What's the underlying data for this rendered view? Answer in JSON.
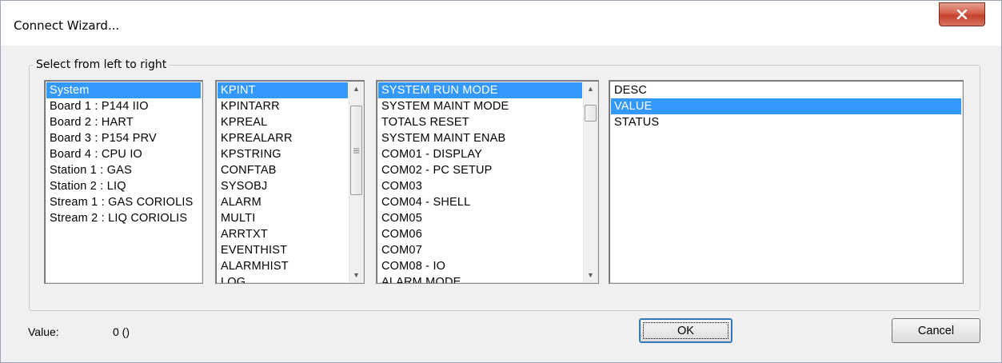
{
  "window": {
    "title": "Connect Wizard...",
    "close_icon": "close-x-icon"
  },
  "group": {
    "label": "Select from left to right"
  },
  "lists": {
    "list1": {
      "items": [
        "System",
        "Board 1 : P144 IIO",
        "Board 2 : HART",
        "Board 3 : P154 PRV",
        "Board 4 : CPU IO",
        "Station 1 : GAS",
        "Station 2 : LIQ",
        "Stream 1 : GAS CORIOLIS",
        "Stream 2 : LIQ CORIOLIS"
      ],
      "selected": "System"
    },
    "list2": {
      "items": [
        "KPINT",
        "KPINTARR",
        "KPREAL",
        "KPREALARR",
        "KPSTRING",
        "CONFTAB",
        "SYSOBJ",
        "ALARM",
        "MULTI",
        "ARRTXT",
        "EVENTHIST",
        "ALARMHIST",
        "LOG"
      ],
      "selected": "KPINT"
    },
    "list3": {
      "items": [
        "SYSTEM RUN MODE",
        "SYSTEM MAINT MODE",
        "TOTALS RESET",
        "SYSTEM MAINT ENAB",
        "COM01 - DISPLAY",
        "COM02 - PC SETUP",
        "COM03",
        "COM04 - SHELL",
        "COM05",
        "COM06",
        "COM07",
        "COM08 - IO",
        "ALARM MODE"
      ],
      "selected": "SYSTEM RUN MODE"
    },
    "list4": {
      "items": [
        "DESC",
        "VALUE",
        "STATUS"
      ],
      "selected": "VALUE"
    }
  },
  "footer": {
    "value_label": "Value:",
    "value_text": "0 ()",
    "ok_label": "OK",
    "cancel_label": "Cancel"
  },
  "colors": {
    "selection": "#3399ff",
    "close_button": "#c7412c"
  }
}
